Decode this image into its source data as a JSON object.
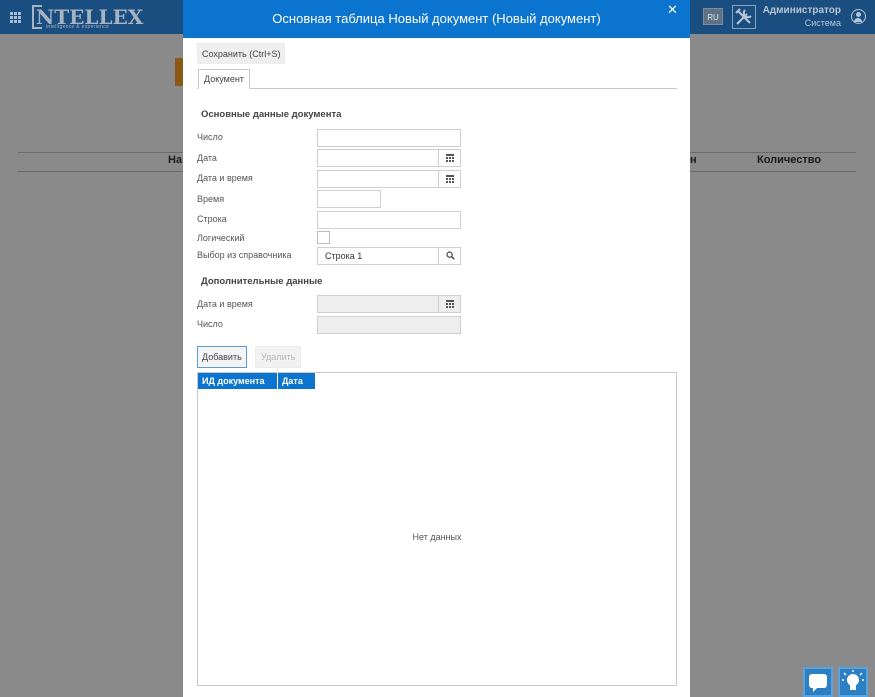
{
  "app": {
    "logo_text": "NTELLEX",
    "logo_tagline": "intelligence & experience",
    "lang": "RU",
    "user_name": "Администратор",
    "user_role": "Система",
    "bg_columns": [
      "На",
      "н",
      "Количество"
    ]
  },
  "dialog": {
    "title": "Основная таблица Новый документ (Новый документ)",
    "close_glyph": "✕",
    "save_label": "Сохранить (Ctrl+S)",
    "tab_label": "Документ",
    "main_section": {
      "title": "Основные данные документа",
      "fields": {
        "number_label": "Число",
        "number_value": "",
        "date_label": "Дата",
        "date_value": "",
        "datetime_label": "Дата и время",
        "datetime_value": "",
        "time_label": "Время",
        "time_value": "",
        "string_label": "Строка",
        "string_value": "",
        "bool_label": "Логический",
        "bool_checked": false,
        "ref_label": "Выбор из справочника",
        "ref_value": "Строка 1"
      }
    },
    "extra_section": {
      "title": "Дополнительные данные",
      "datetime_label": "Дата и время",
      "datetime_value": "",
      "number_label": "Число",
      "number_value": ""
    },
    "add_label": "Добавить",
    "delete_label": "Удалить",
    "grid": {
      "columns": [
        "ИД документа",
        "Дата"
      ],
      "empty_text": "Нет данных"
    }
  }
}
